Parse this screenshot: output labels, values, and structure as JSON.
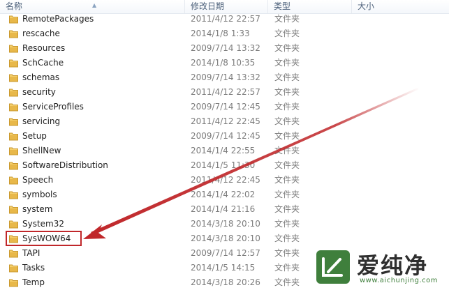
{
  "columns": {
    "name": "名称",
    "date": "修改日期",
    "type": "类型",
    "size": "大小"
  },
  "rows": [
    {
      "name": "RemotePackages",
      "date": "2011/4/12 22:57",
      "type": "文件夹"
    },
    {
      "name": "rescache",
      "date": "2014/1/8 1:33",
      "type": "文件夹"
    },
    {
      "name": "Resources",
      "date": "2009/7/14 13:32",
      "type": "文件夹"
    },
    {
      "name": "SchCache",
      "date": "2014/1/8 10:35",
      "type": "文件夹"
    },
    {
      "name": "schemas",
      "date": "2009/7/14 13:32",
      "type": "文件夹"
    },
    {
      "name": "security",
      "date": "2011/4/12 22:57",
      "type": "文件夹"
    },
    {
      "name": "ServiceProfiles",
      "date": "2009/7/14 12:45",
      "type": "文件夹"
    },
    {
      "name": "servicing",
      "date": "2011/4/12 22:45",
      "type": "文件夹"
    },
    {
      "name": "Setup",
      "date": "2009/7/14 12:45",
      "type": "文件夹"
    },
    {
      "name": "ShellNew",
      "date": "2014/1/4 22:55",
      "type": "文件夹"
    },
    {
      "name": "SoftwareDistribution",
      "date": "2014/1/5 11:30",
      "type": "文件夹"
    },
    {
      "name": "Speech",
      "date": "2011/4/12 22:45",
      "type": "文件夹"
    },
    {
      "name": "symbols",
      "date": "2014/1/4 22:02",
      "type": "文件夹"
    },
    {
      "name": "system",
      "date": "2014/1/4 21:16",
      "type": "文件夹"
    },
    {
      "name": "System32",
      "date": "2014/3/18 20:10",
      "type": "文件夹"
    },
    {
      "name": "SysWOW64",
      "date": "2014/3/18 20:10",
      "type": "文件夹"
    },
    {
      "name": "TAPI",
      "date": "2009/7/14 12:57",
      "type": "文件夹"
    },
    {
      "name": "Tasks",
      "date": "2014/1/5 14:15",
      "type": "文件夹"
    },
    {
      "name": "Temp",
      "date": "2014/3/18 20:26",
      "type": "文件夹"
    }
  ],
  "annotation": {
    "target": "SysWOW64",
    "color": "#c0272a"
  },
  "watermark": {
    "text": "爱纯净",
    "url": "www.aichunjing.com"
  },
  "colors": {
    "folder": "#e8b84a",
    "header_text": "#4c607a",
    "secondary_text": "#7c7c7c",
    "watermark_green": "#3f7f3c"
  }
}
